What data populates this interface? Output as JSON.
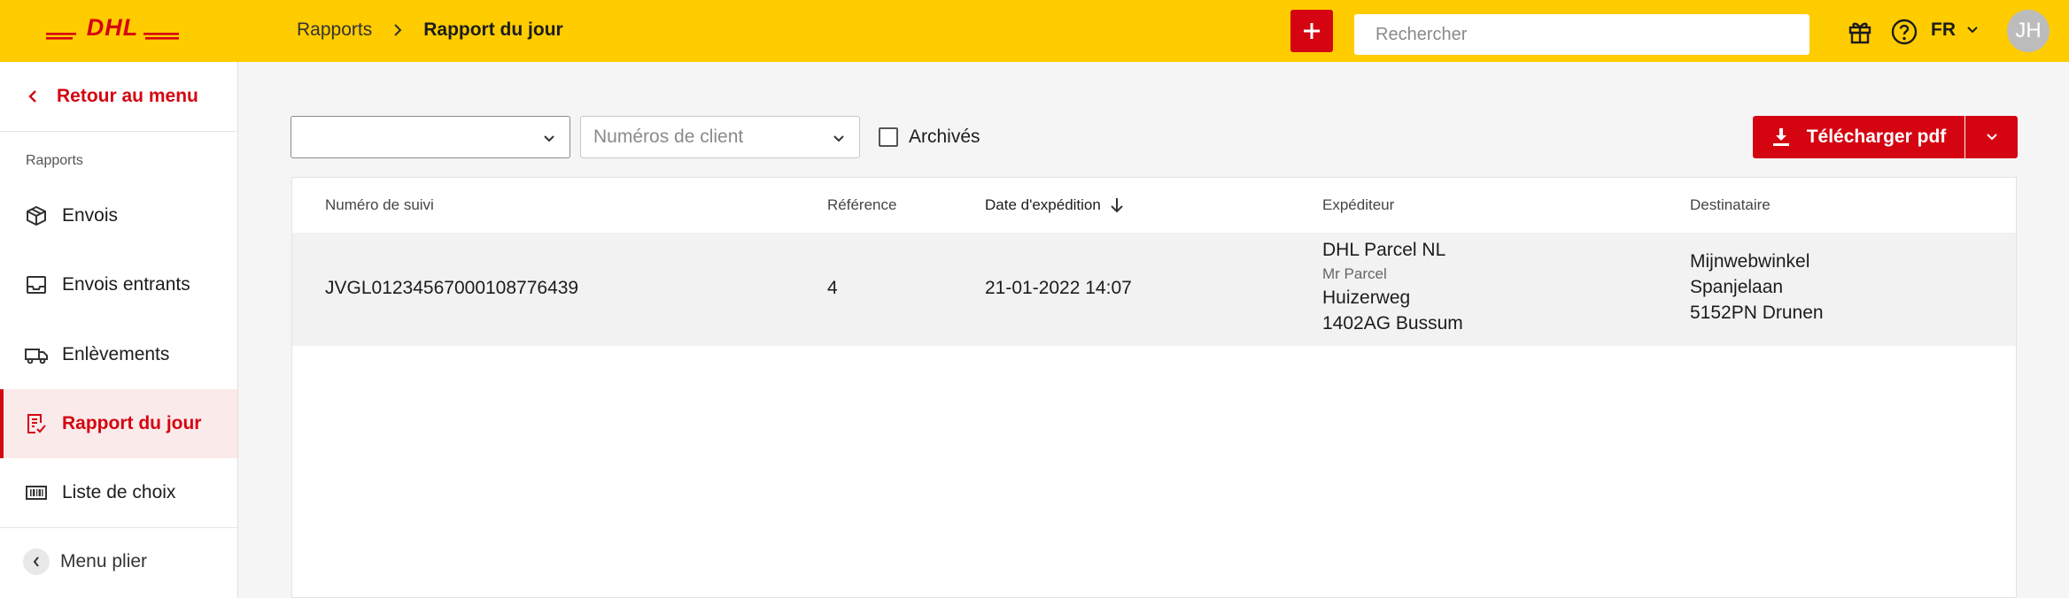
{
  "header": {
    "logo_text": "DHL",
    "breadcrumb": {
      "parent": "Rapports",
      "current": "Rapport du jour"
    },
    "search_placeholder": "Rechercher",
    "language": "FR",
    "avatar_initials": "JH",
    "brand_color": "#ffcc00",
    "accent_color": "#d40511"
  },
  "sidebar": {
    "back_label": "Retour au menu",
    "section_label": "Rapports",
    "items": [
      {
        "label": "Envois",
        "icon": "package-icon",
        "active": false
      },
      {
        "label": "Envois entrants",
        "icon": "inbox-icon",
        "active": false
      },
      {
        "label": "Enlèvements",
        "icon": "truck-icon",
        "active": false
      },
      {
        "label": "Rapport du jour",
        "icon": "report-icon",
        "active": true
      },
      {
        "label": "Liste de choix",
        "icon": "barcode-icon",
        "active": false
      }
    ],
    "collapse_label": "Menu plier"
  },
  "filters": {
    "select1_value": "",
    "customer_numbers_placeholder": "Numéros de client",
    "archived_label": "Archivés",
    "archived_checked": false,
    "download_label": "Télécharger pdf"
  },
  "table": {
    "columns": [
      "Numéro de suivi",
      "Référence",
      "Date d'expédition",
      "Expéditeur",
      "Destinataire"
    ],
    "sorted_column": "Date d'expédition",
    "sort_direction": "descending",
    "rows": [
      {
        "tracking": "JVGL01234567000108776439",
        "reference": "4",
        "date": "21-01-2022 14:07",
        "sender": {
          "company": "DHL Parcel NL",
          "contact": "Mr Parcel",
          "street": "Huizerweg",
          "city": "1402AG Bussum"
        },
        "recipient": {
          "name": "Mijnwebwinkel",
          "street": "Spanjelaan",
          "city": "5152PN Drunen"
        }
      }
    ]
  }
}
